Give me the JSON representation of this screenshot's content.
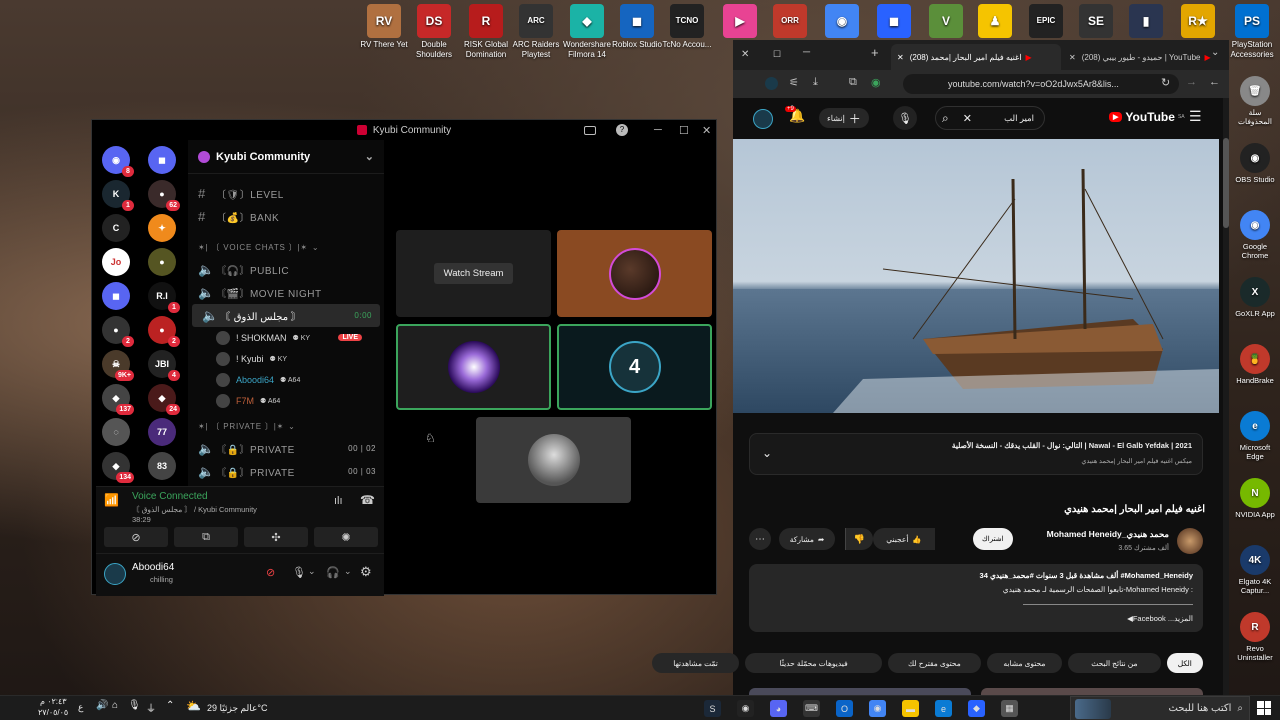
{
  "desktop_icons": [
    {
      "label": "RV There Yet",
      "color": "#b07040",
      "glyph": "RV"
    },
    {
      "label": "Double Shoulders",
      "color": "#c62828",
      "glyph": "DS"
    },
    {
      "label": "RISK Global Domination",
      "color": "#b71c1c",
      "glyph": "R"
    },
    {
      "label": "ARC Raiders Playtest",
      "color": "#333",
      "glyph": "ARC"
    },
    {
      "label": "Wondershare Filmora 14",
      "color": "#1bb3a6",
      "glyph": "◆"
    },
    {
      "label": "Roblox Studio",
      "color": "#1565c0",
      "glyph": "◼"
    },
    {
      "label": "TcNo Accou...",
      "color": "#222",
      "glyph": "TCNO"
    },
    {
      "label": "",
      "color": "#e84393",
      "glyph": "▶"
    },
    {
      "label": "",
      "color": "#c0392b",
      "glyph": "ORR"
    },
    {
      "label": "",
      "color": "#4285f4",
      "glyph": "◉"
    },
    {
      "label": "",
      "color": "#2962ff",
      "glyph": "◼"
    },
    {
      "label": "",
      "color": "#5b8f3a",
      "glyph": "V"
    },
    {
      "label": "",
      "color": "#f5c400",
      "glyph": "♟"
    },
    {
      "label": "",
      "color": "#222",
      "glyph": "EPIC"
    },
    {
      "label": "",
      "color": "#333",
      "glyph": "SE"
    },
    {
      "label": "",
      "color": "#2a3550",
      "glyph": "▮"
    },
    {
      "label": "",
      "color": "#e3a600",
      "glyph": "R★"
    },
    {
      "label": "PlayStation Accessories",
      "color": "#0070d1",
      "glyph": "PS"
    }
  ],
  "discord": {
    "window_title": "Kyubi Community",
    "server_name": "Kyubi Community",
    "servers_left": [
      {
        "color": "#5865f2",
        "badge": "8",
        "glyph": "◉"
      },
      {
        "color": "#1a2730",
        "badge": "1",
        "glyph": "K"
      },
      {
        "color": "#222",
        "badge": "",
        "glyph": "C"
      },
      {
        "color": "#fff",
        "badge": "",
        "glyph": "Jo"
      },
      {
        "color": "#5865f2",
        "badge": "",
        "glyph": "◼"
      },
      {
        "color": "#333",
        "badge": "2",
        "glyph": "●"
      },
      {
        "color": "#4a3a2a",
        "badge": "9K+",
        "glyph": "☠"
      },
      {
        "color": "#444",
        "badge": "137",
        "glyph": "◆"
      },
      {
        "color": "#555",
        "badge": "",
        "glyph": "◌"
      },
      {
        "color": "#333",
        "badge": "134",
        "glyph": "◆"
      },
      {
        "color": "#ed4245",
        "badge": "",
        "glyph": "NEW"
      }
    ],
    "servers_right": [
      {
        "color": "#5865f2",
        "badge": "",
        "glyph": "◼"
      },
      {
        "color": "#3a2a2a",
        "badge": "62",
        "glyph": "●"
      },
      {
        "color": "#f08a1c",
        "badge": "",
        "glyph": "✦"
      },
      {
        "color": "#552",
        "badge": "",
        "glyph": "●"
      },
      {
        "color": "#111",
        "badge": "1",
        "glyph": "R.I"
      },
      {
        "color": "#b22",
        "badge": "2",
        "glyph": "●"
      },
      {
        "color": "#222",
        "badge": "4",
        "glyph": "JBI"
      },
      {
        "color": "#4a1a1a",
        "badge": "24",
        "glyph": "◆"
      },
      {
        "color": "#4a2a7a",
        "badge": "",
        "glyph": "77"
      },
      {
        "color": "#444",
        "badge": "",
        "glyph": "83"
      }
    ],
    "channels": [
      {
        "icon": "#",
        "label": "〔🛡〕LEVEL"
      },
      {
        "icon": "#",
        "label": "〔💰〕BANK"
      }
    ],
    "voice_category": "✶| 〔 VOICE CHATS 〕|✶",
    "voice_channels": [
      {
        "label": "〘🎧〙PUBLIC"
      },
      {
        "label": "〘🎬〙MOVIE NIGHT"
      }
    ],
    "active_channel": {
      "label": "〘 مجلس الذوق 〙",
      "timer": "0:00"
    },
    "voice_users": [
      {
        "name": "! SHOKMAN",
        "tag": "KY",
        "live": "LIVE",
        "color": "#ddd"
      },
      {
        "name": "! Kyubi",
        "tag": "KY",
        "live": "",
        "color": "#ddd"
      },
      {
        "name": "Aboodi64",
        "tag": "A64",
        "live": "",
        "color": "#3ba5c6"
      },
      {
        "name": "F7M",
        "tag": "A64",
        "live": "",
        "color": "#c0603a"
      }
    ],
    "private_category": "✶| 〔 PRIVATE 〕|✶",
    "private_channels": [
      {
        "label": "〘🔒〙PRIVATE",
        "count_a": "00",
        "count_b": "02"
      },
      {
        "label": "〘🔒〙PRIVATE",
        "count_a": "00",
        "count_b": "03"
      }
    ],
    "voice_status": "Voice Connected",
    "voice_location": "〘 مجلس الذوق 〙 / Kyubi Community",
    "voice_time": "38:29",
    "user_name": "Aboodi64",
    "user_status": "chilling",
    "watch_stream": "Watch Stream"
  },
  "chrome": {
    "tabs": [
      {
        "label": "(208) حميدو - طيور بيبي | YouTube"
      },
      {
        "label": "(208) اغنيه فيلم امير البحار |محمد"
      }
    ],
    "url": "youtube.com/watch?v=oO2dJwx5Ar8&lis..."
  },
  "youtube": {
    "logo": "YouTube",
    "logo_suffix": "SA",
    "search_value": "امير الب",
    "create_label": "إنشاء",
    "notif_badge": "+9",
    "playlist_next": "التالي: نوال - القلب يدقك - النسخة الأصلية | Nawal - El Galb Yefdak | 2021",
    "playlist_sub": "ميكس اغنيه فيلم امير البحار |محمد هنيدي",
    "video_title": "اغنيه فيلم امير البحار |محمد هنيدي",
    "channel_name": "Mohamed Heneidy_محمد هنيدي",
    "subscribers": "3.65 ألف مشترك",
    "subscribe_label": "اشتراك",
    "like_label": "أعجبني",
    "share_label": "مشاركة",
    "desc_stats": "34 ألف مشاهدة  قبل 3 سنوات  #محمد_هنيدي  #Mohamed_Heneidy",
    "desc_line1": "تابعوا الصفحات الرسمية لـ محمد هنيدي-Mohamed Heneidy  :",
    "desc_line2": "◀Facebook ...المزيد",
    "chips": [
      "الكل",
      "من نتائج البحث",
      "محتوى مشابه",
      "محتوى مقترح لك",
      "فيديوهات محمّلة حديثًا",
      "تمّت مشاهدتها"
    ]
  },
  "right_icons": [
    {
      "label": "سلة المحذوفات",
      "color": "#888",
      "glyph": "🗑"
    },
    {
      "label": "OBS Studio",
      "color": "#222",
      "glyph": "◉"
    },
    {
      "label": "Google Chrome",
      "color": "#4285f4",
      "glyph": "◉"
    },
    {
      "label": "GoXLR App",
      "color": "#1a2a2a",
      "glyph": "X"
    },
    {
      "label": "HandBrake",
      "color": "#c0392b",
      "glyph": "🍍"
    },
    {
      "label": "Microsoft Edge",
      "color": "#0a7bd4",
      "glyph": "e"
    },
    {
      "label": "NVIDIA App",
      "color": "#76b900",
      "glyph": "N"
    },
    {
      "label": "Elgato 4K Captur...",
      "color": "#1a3a6a",
      "glyph": "4K"
    },
    {
      "label": "Revo Uninstaller",
      "color": "#c0392b",
      "glyph": "R"
    }
  ],
  "taskbar": {
    "search_placeholder": "اكتب هنا للبحث",
    "weather": "عالم جزئيًا  29°C",
    "time": "٠٢:٤٣ م",
    "date": "٢٧/٠٥/٠٥",
    "lang": "ع"
  }
}
